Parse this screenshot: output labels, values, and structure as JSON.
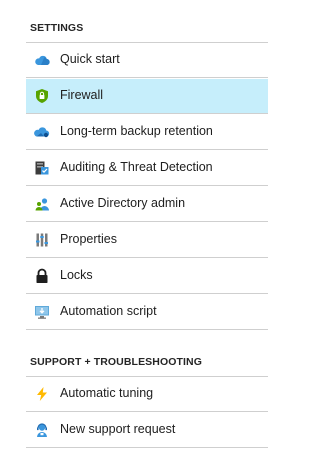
{
  "sections": [
    {
      "title": "SETTINGS",
      "items": [
        {
          "label": "Quick start",
          "icon": "cloud-icon",
          "selected": false
        },
        {
          "label": "Firewall",
          "icon": "shield-icon",
          "selected": true
        },
        {
          "label": "Long-term backup retention",
          "icon": "cloud-backup-icon",
          "selected": false
        },
        {
          "label": "Auditing & Threat Detection",
          "icon": "auditing-icon",
          "selected": false
        },
        {
          "label": "Active Directory admin",
          "icon": "user-admin-icon",
          "selected": false
        },
        {
          "label": "Properties",
          "icon": "properties-icon",
          "selected": false
        },
        {
          "label": "Locks",
          "icon": "lock-icon",
          "selected": false
        },
        {
          "label": "Automation script",
          "icon": "automation-script-icon",
          "selected": false
        }
      ]
    },
    {
      "title": "SUPPORT + TROUBLESHOOTING",
      "items": [
        {
          "label": "Automatic tuning",
          "icon": "lightning-icon",
          "selected": false
        },
        {
          "label": "New support request",
          "icon": "support-request-icon",
          "selected": false
        }
      ]
    }
  ],
  "colors": {
    "selected_background": "#c6eefb",
    "divider": "#cfcfcf",
    "accent_blue": "#3a96dd",
    "accent_green": "#57a300",
    "lightning_yellow": "#ffb900"
  }
}
